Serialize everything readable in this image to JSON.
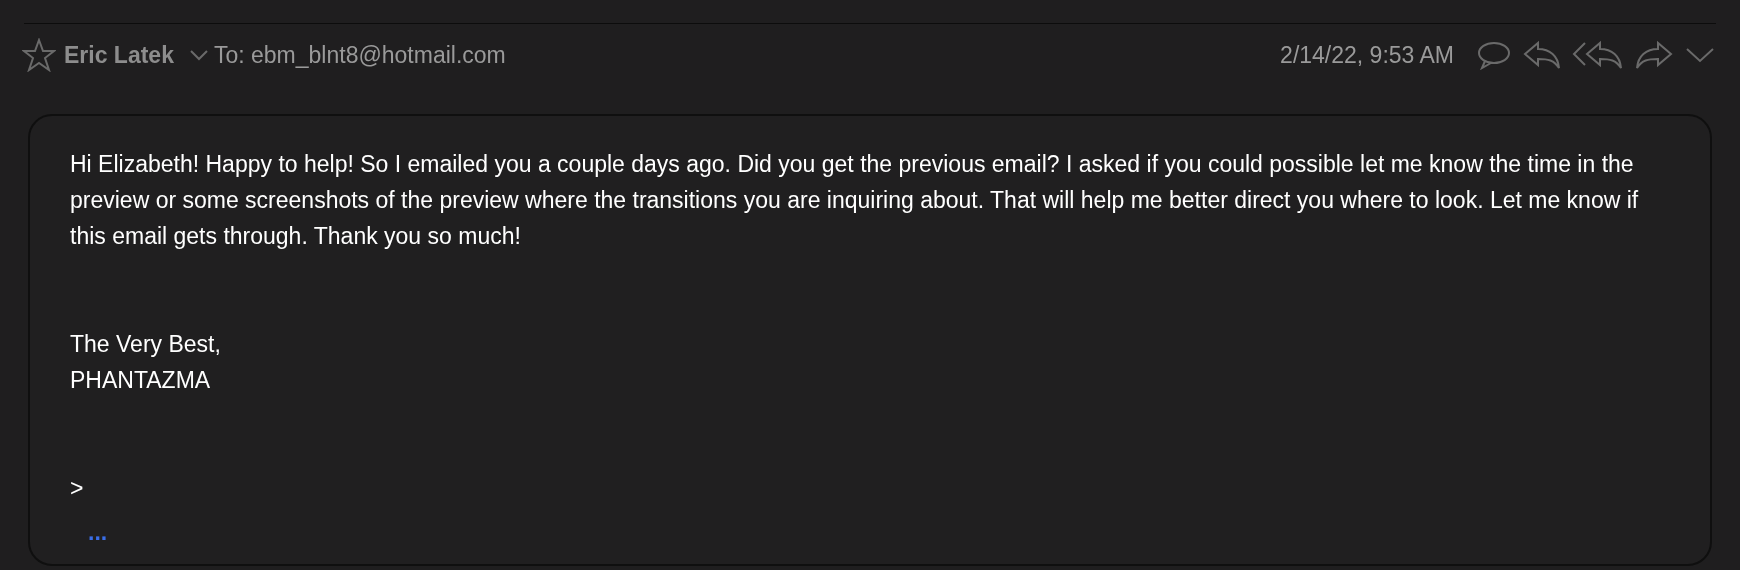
{
  "header": {
    "flagged": false,
    "sender": "Eric Latek",
    "to": "To: ebm_blnt8@hotmail.com",
    "date": "2/14/22, 9:53 AM"
  },
  "body": {
    "paragraphs": [
      "Hi Elizabeth! Happy to help! So I emailed you a couple days ago. Did you get the previous email? I asked if you could possible let me know the time in the preview or some screenshots of the preview where the transitions you are inquiring about. That will help me better direct you where to look. Let me know if this email gets through. Thank you so much!",
      "The Very Best,\nPHANTAZMA",
      ">"
    ],
    "more": "..."
  }
}
